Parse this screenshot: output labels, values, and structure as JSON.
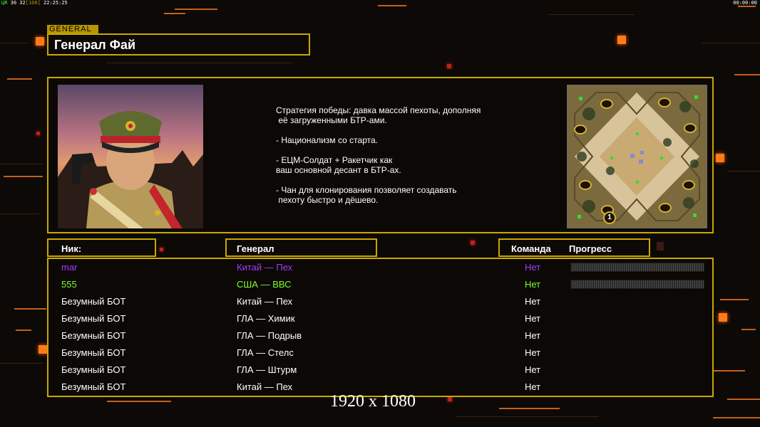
{
  "hud": {
    "left_g": "ЦR",
    "left_w": " 30 32",
    "left_y": "[100]",
    "left_time": " 22:25:25",
    "right": "00:00:00"
  },
  "general": {
    "tag": "GENERAL",
    "name": "Генерал Фай",
    "strategy": "Стратегия победы: давка массой пехоты, дополняя\n её загруженными БТР-ами.\n\n- Национализм со старта.\n\n- ЕЦМ-Солдат + Ракетчик как\nваш основной десант в БТР-ах.\n\n- Чан для клонирования позволяет создавать\n пехоту быстро и дёшево."
  },
  "headers": {
    "nick": "Ник:",
    "general": "Генерал",
    "team": "Команда",
    "progress": "Прогресс"
  },
  "players": [
    {
      "nick": "mar",
      "general": "Китай — Пех",
      "team": "Нет",
      "color": "#a43cff",
      "progress": true
    },
    {
      "nick": "555",
      "general": "США — ВВС",
      "team": "Нет",
      "color": "#7cff2a",
      "progress": true
    },
    {
      "nick": "Безумный БОТ",
      "general": "Китай — Пех",
      "team": "Нет",
      "color": "#ffffff",
      "progress": false
    },
    {
      "nick": "Безумный БОТ",
      "general": "ГЛА — Химик",
      "team": "Нет",
      "color": "#ffffff",
      "progress": false
    },
    {
      "nick": "Безумный БОТ",
      "general": "ГЛА — Подрыв",
      "team": "Нет",
      "color": "#ffffff",
      "progress": false
    },
    {
      "nick": "Безумный БОТ",
      "general": "ГЛА — Стелс",
      "team": "Нет",
      "color": "#ffffff",
      "progress": false
    },
    {
      "nick": "Безумный БОТ",
      "general": "ГЛА — Штурм",
      "team": "Нет",
      "color": "#ffffff",
      "progress": false
    },
    {
      "nick": "Безумный БОТ",
      "general": "Китай — Пех",
      "team": "Нет",
      "color": "#ffffff",
      "progress": false
    }
  ],
  "minimap": {
    "marker_label": "1"
  },
  "resolution": "1920 x 1080",
  "colors": {
    "frame": "#c8a800",
    "accent": "#ff7a1a"
  }
}
